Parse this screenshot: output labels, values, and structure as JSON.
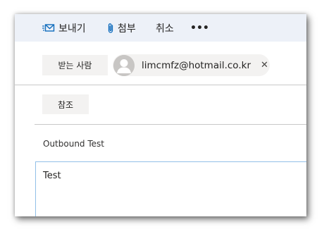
{
  "toolbar": {
    "send_label": "보내기",
    "attach_label": "첨부",
    "cancel_label": "취소",
    "more_label": "•••"
  },
  "recipients": {
    "to_button_label": "받는 사람",
    "cc_button_label": "참조",
    "to": [
      {
        "email": "limcmfz@hotmail.co.kr",
        "remove_label": "✕"
      }
    ]
  },
  "subject": "Outbound Test",
  "body_text": "Test",
  "colors": {
    "toolbar_bg": "#edf1f8",
    "accent": "#0f6cbd",
    "button_bg": "#f3f2f1",
    "divider": "#c8c8c8",
    "focus_border": "#92c0e8"
  },
  "icons": {
    "send": "send-icon",
    "attach": "paperclip-icon",
    "avatar": "person-icon",
    "remove": "close-icon"
  }
}
